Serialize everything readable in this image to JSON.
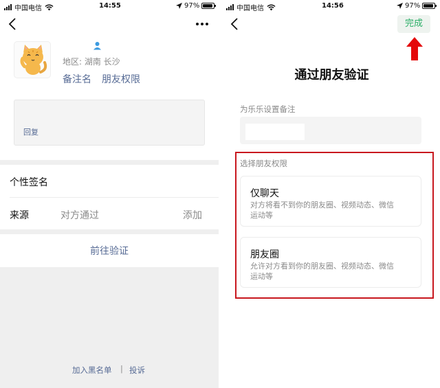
{
  "left": {
    "status": {
      "carrier": "中国电信",
      "time": "14:55",
      "battery": "97%"
    },
    "profile": {
      "region": "地区: 湖南 长沙",
      "links": [
        "备注名",
        "朋友权限"
      ]
    },
    "message": {
      "reply": "回复"
    },
    "rows": {
      "signature": "个性签名",
      "source_label": "来源",
      "source_value": "对方通过",
      "add": "添加"
    },
    "verify_button": "前往验证",
    "footer": {
      "blacklist": "加入黑名单",
      "sep": "|",
      "report": "投诉"
    }
  },
  "right": {
    "status": {
      "carrier": "中国电信",
      "time": "14:56",
      "battery": "97%"
    },
    "done": "完成",
    "title": "通过朋友验证",
    "remark_label": "为乐乐设置备注",
    "perm_label": "选择朋友权限",
    "options": [
      {
        "title": "仅聊天",
        "desc": "对方将看不到你的朋友圈、视频动态、微信运动等"
      },
      {
        "title": "朋友圈",
        "desc": "允许对方看到你的朋友圈、视频动态、微信运动等"
      }
    ]
  },
  "colors": {
    "accent_green": "#2aae67",
    "link_blue": "#576b95",
    "highlight_red": "#c8171e",
    "arrow_red": "#e4080a"
  },
  "icons": [
    "wifi-icon",
    "location-arrow-icon",
    "back-icon",
    "more-icon",
    "person-icon",
    "cat-avatar",
    "up-arrow-icon"
  ]
}
